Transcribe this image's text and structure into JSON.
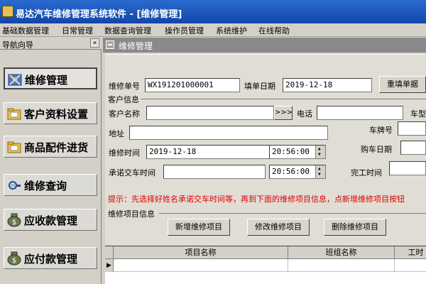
{
  "window": {
    "title": "易达汽车维修管理系统软件 - [维修管理]"
  },
  "menu": [
    "基础数据管理",
    "日常管理",
    "数据查询管理",
    "操作员管理",
    "系统维护",
    "在线帮助"
  ],
  "nav": {
    "title": "导航向导",
    "collapse": "«",
    "items": [
      {
        "label": "维修管理",
        "icon": "repair-tools-icon"
      },
      {
        "label": "客户资料设置",
        "icon": "folder-icon"
      },
      {
        "label": "商品配件进货",
        "icon": "folder-icon"
      },
      {
        "label": "维修查询",
        "icon": "search-key-icon"
      },
      {
        "label": "应收款管理",
        "icon": "money-bag-icon"
      },
      {
        "label": "应付款管理",
        "icon": "money-bag-icon"
      }
    ]
  },
  "panel": {
    "title": "维修管理"
  },
  "form": {
    "order_no_label": "维修单号",
    "order_no_value": "WX191201000001",
    "fill_date_label": "填单日期",
    "fill_date_value": "2019-12-18",
    "refill_button": "重填单据",
    "customer_group": "客户信息",
    "customer_name_label": "客户名称",
    "customer_name_value": "",
    "lookup_button": ">>>",
    "phone_label": "电话",
    "phone_value": "",
    "car_type_label": "车型",
    "address_label": "地址",
    "address_value": "",
    "plate_label": "车牌号",
    "repair_time_label": "维修时间",
    "repair_date_value": "2019-12-18",
    "repair_clock_value": "20:56:00",
    "buy_date_label": "购车日期",
    "promise_time_label": "承诺交车时间",
    "promise_date_value": "",
    "promise_clock_value": "20:56:00",
    "finish_time_label": "完工时间",
    "hint": "提示：先选择好姓名承诺交车时间等，再到下面的维修项目信息，点新增维修项目按钮",
    "items_group": "维修项目信息",
    "add_item_button": "新增维修项目",
    "edit_item_button": "修改维修项目",
    "delete_item_button": "删除维修项目"
  },
  "grid": {
    "columns": [
      "项目名称",
      "班组名称",
      "工时"
    ],
    "row_indicator": "▶"
  }
}
